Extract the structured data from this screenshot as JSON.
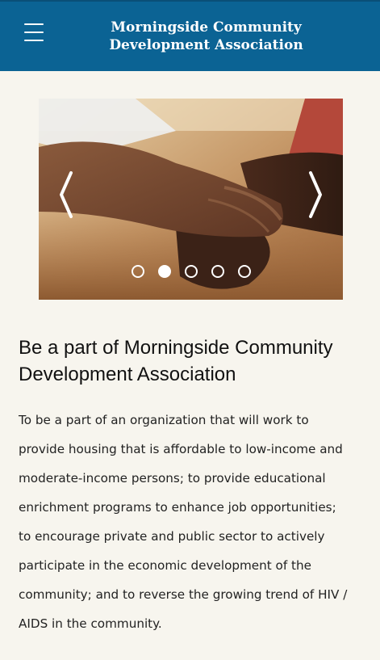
{
  "header": {
    "title_line1": "Morningside Community",
    "title_line2": "Development Association",
    "menu_icon": "hamburger-menu-icon",
    "background": "#0b6394"
  },
  "carousel": {
    "prev_icon": "chevron-left-icon",
    "next_icon": "chevron-right-icon",
    "slide_count": 5,
    "active_slide": 2,
    "image_subject": "photo-of-stacked-hands"
  },
  "content": {
    "heading": "Be a part of Morningside Community Development Association",
    "body_lines": [
      "To be a part of an organization that will work to",
      "provide housing that is affordable to low-income and",
      "moderate-income persons; to provide educational",
      "enrichment programs to enhance job opportunities;",
      "to encourage private and public sector to actively",
      "participate in the economic development of the",
      "community; and to reverse the growing trend of HIV /",
      "AIDS in the community."
    ]
  }
}
